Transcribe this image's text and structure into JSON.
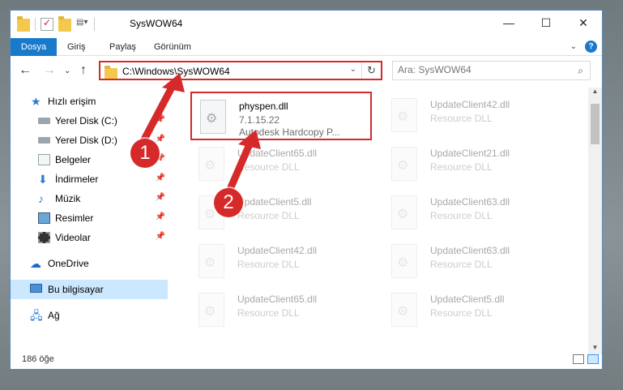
{
  "window": {
    "title": "SysWOW64",
    "controls": {
      "minimize": "—",
      "maximize": "☐",
      "close": "✕"
    }
  },
  "ribbon": {
    "tabs": [
      "Dosya",
      "Giriş",
      "Paylaş",
      "Görünüm"
    ],
    "help": "?"
  },
  "navigation": {
    "address_path": "C:\\Windows\\SysWOW64",
    "search_placeholder": "Ara: SysWOW64"
  },
  "sidebar": {
    "items": [
      {
        "label": "Hızlı erişim",
        "icon": "star-icon"
      },
      {
        "label": "Yerel Disk (C:)",
        "icon": "drive-icon"
      },
      {
        "label": "Yerel Disk (D:)",
        "icon": "drive-icon"
      },
      {
        "label": "Belgeler",
        "icon": "documents-icon"
      },
      {
        "label": "İndirmeler",
        "icon": "download-icon"
      },
      {
        "label": "Müzik",
        "icon": "music-icon"
      },
      {
        "label": "Resimler",
        "icon": "pictures-icon"
      },
      {
        "label": "Videolar",
        "icon": "videos-icon"
      },
      {
        "label": "OneDrive",
        "icon": "cloud-icon"
      },
      {
        "label": "Bu bilgisayar",
        "icon": "computer-icon"
      },
      {
        "label": "Ağ",
        "icon": "network-icon"
      }
    ]
  },
  "files": [
    {
      "name": "physpen.dll",
      "line2": "7.1.15.22",
      "line3": "Autodesk Hardcopy P..."
    },
    {
      "name": "UpdateClient42.dll",
      "line2": "Resource DLL"
    },
    {
      "name": "UpdateClient65.dll",
      "line2": "Resource DLL"
    },
    {
      "name": "UpdateClient21.dll",
      "line2": "Resource DLL"
    },
    {
      "name": "UpdateClient5.dll",
      "line2": "Resource DLL"
    },
    {
      "name": "UpdateClient63.dll",
      "line2": "Resource DLL"
    },
    {
      "name": "UpdateClient42.dll",
      "line2": "Resource DLL"
    },
    {
      "name": "UpdateClient63.dll",
      "line2": "Resource DLL"
    },
    {
      "name": "UpdateClient65.dll",
      "line2": "Resource DLL"
    },
    {
      "name": "UpdateClient5.dll",
      "line2": "Resource DLL"
    }
  ],
  "status": {
    "item_count": "186 öğe"
  },
  "annotations": {
    "step1": "1",
    "step2": "2",
    "color": "#d62a2a"
  }
}
